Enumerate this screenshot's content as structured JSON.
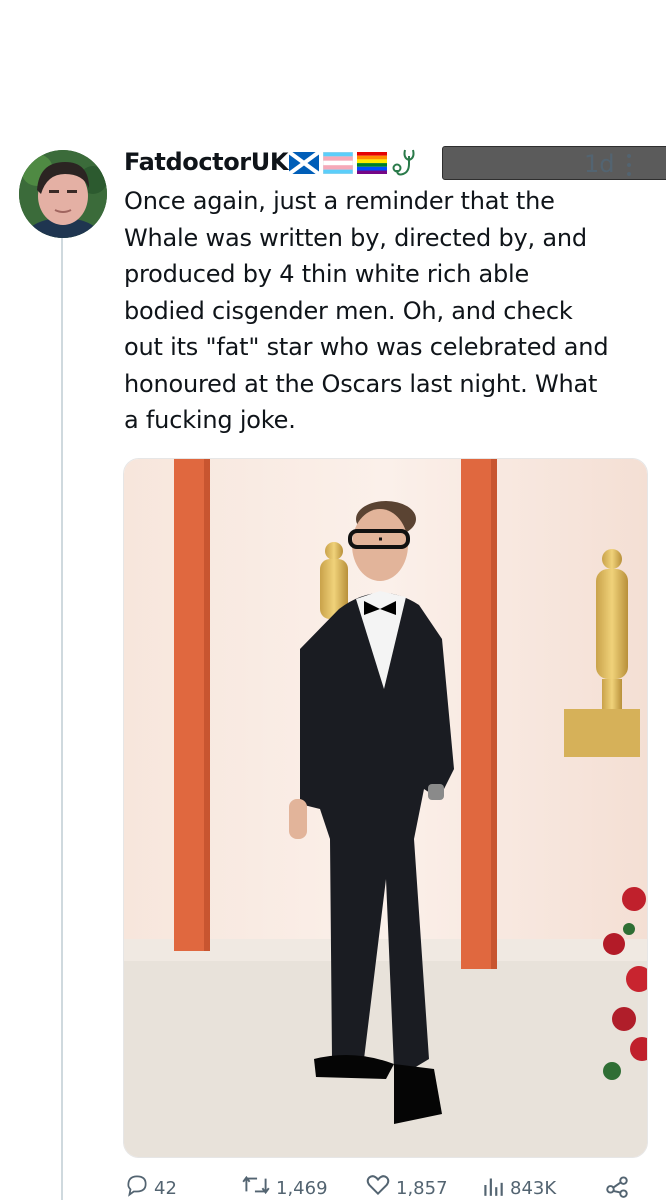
{
  "tweet": {
    "display_name": "FatdoctorUK",
    "timestamp": "1d",
    "text": "Once again, just a reminder that the\nWhale was written by, directed by, and\nproduced by 4 thin white rich able\nbodied cisgender men. Oh, and check\nout its \"fat\" star who was celebrated and\nhonoured at the Oscars last night. What\na fucking joke.",
    "name_emoji_icons": [
      "scotland-flag-icon",
      "transgender-flag-icon",
      "rainbow-flag-icon",
      "stethoscope-icon"
    ],
    "handle_redacted": true
  },
  "media": {
    "description_icon": "red-carpet-photo"
  },
  "actions": {
    "replies": "42",
    "retweets": "1,469",
    "likes": "1,857",
    "views": "843K"
  },
  "colors": {
    "text": "#0f1419",
    "muted": "#536471",
    "thread_line": "#cfd9de"
  }
}
